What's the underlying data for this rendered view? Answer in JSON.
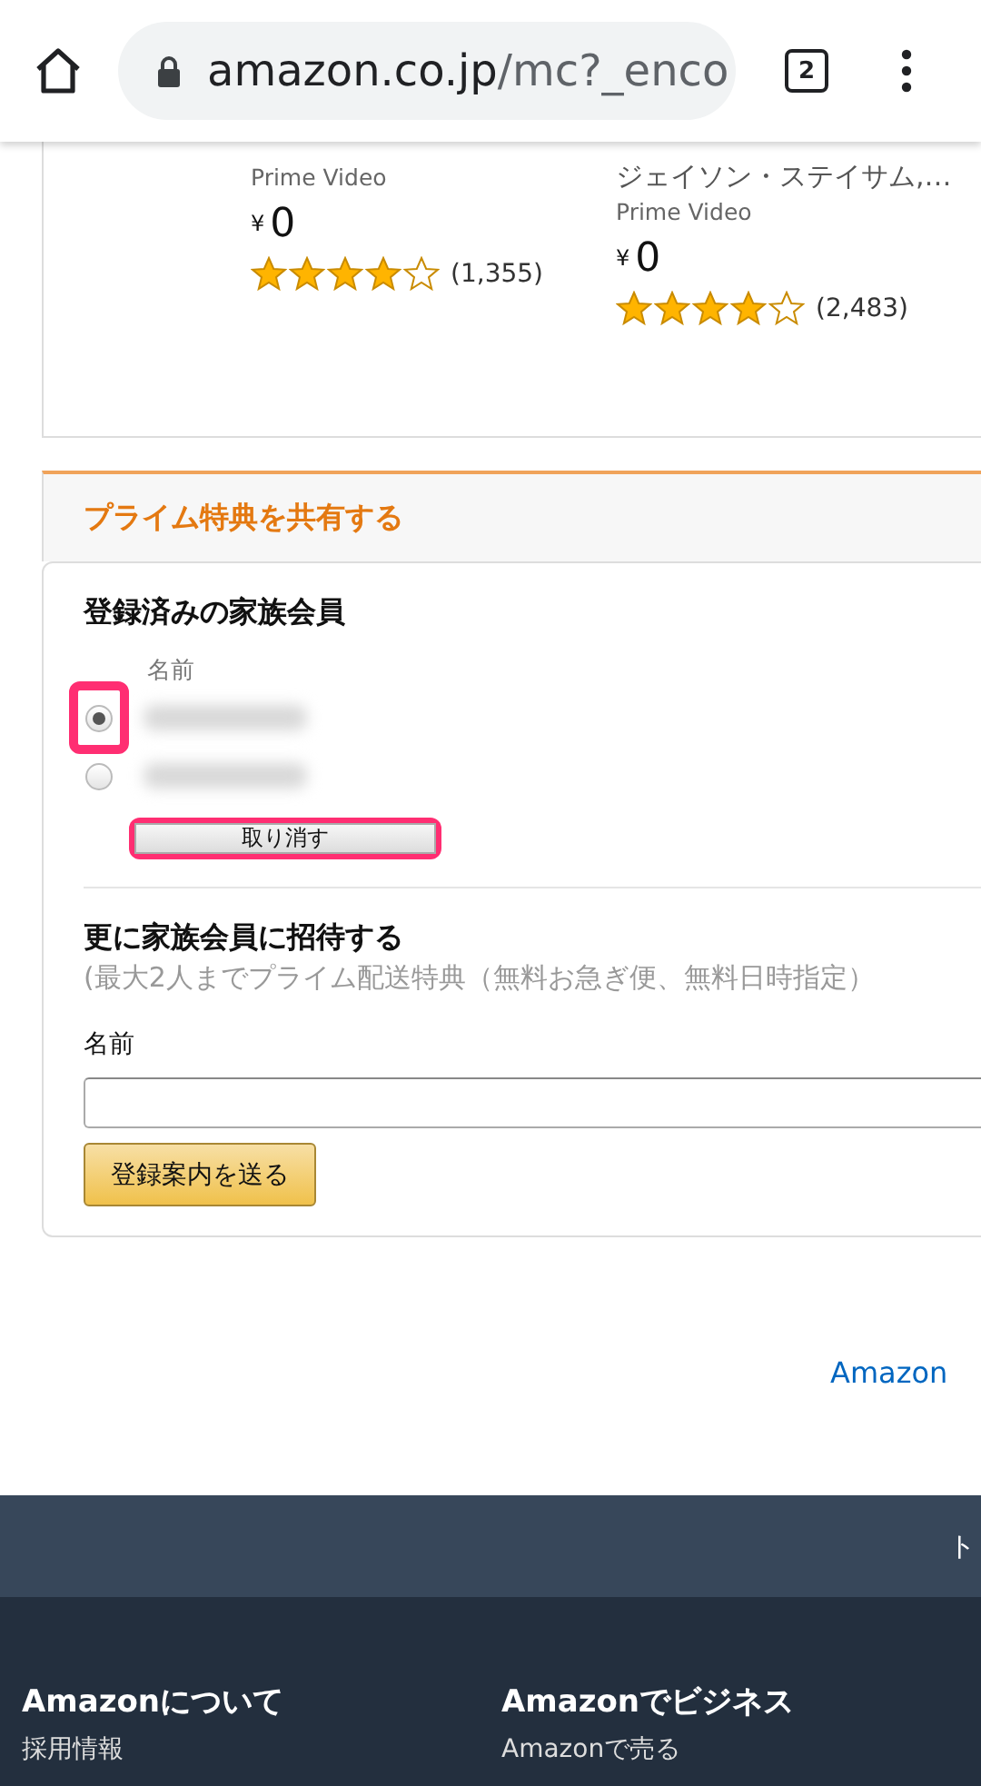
{
  "browser": {
    "url_host": "amazon.co.jp",
    "url_path": "/mc?_enco",
    "tab_count": "2"
  },
  "products": [
    {
      "source": "Prime Video",
      "price_symbol": "¥",
      "price": "0",
      "stars": 4,
      "review_count": "(1,355)"
    },
    {
      "cast": "ジェイソン・ステイサム,…",
      "source": "Prime Video",
      "price_symbol": "¥",
      "price": "0",
      "stars": 4,
      "review_count": "(2,483)"
    }
  ],
  "share_section": {
    "title": "プライム特典を共有する",
    "registered": {
      "heading": "登録済みの家族会員",
      "name_label": "名前",
      "members": [
        {
          "selected": true,
          "highlighted": true
        },
        {
          "selected": false,
          "highlighted": false
        }
      ],
      "cancel_button": {
        "label": "取り消す",
        "highlighted": true
      }
    },
    "invite": {
      "heading": "更に家族会員に招待する",
      "note": "(最大2人までプライム配送特典（無料お急ぎ便、無料日時指定）",
      "name_label": "名前",
      "send_button": "登録案内を送る"
    }
  },
  "prime_link": "Amazon",
  "back_to_top": "ト",
  "footer_columns": [
    {
      "heading": "Amazonについて",
      "links": [
        "採用情報"
      ]
    },
    {
      "heading": "Amazonでビジネス",
      "links": [
        "Amazonで売る"
      ]
    }
  ]
}
